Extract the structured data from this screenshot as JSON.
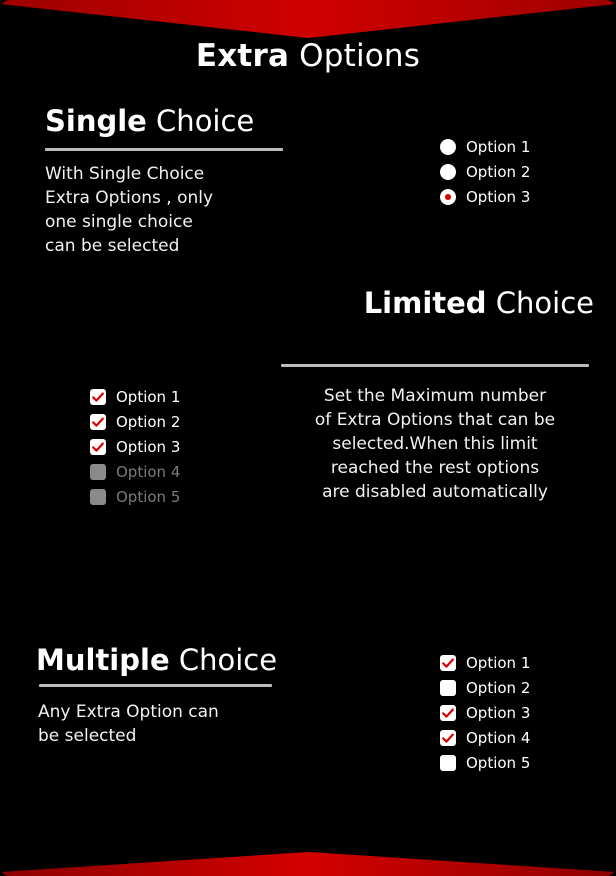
{
  "page": {
    "title_strong": "Extra",
    "title_light": " Options",
    "background_color": "#000000",
    "accent_color": "#d80000",
    "divider_color": "#bcbcbc",
    "disabled_color": "#7b7b7b"
  },
  "decor": {
    "top_chevron_name": "top-red-chevron",
    "bottom_chevron_name": "bottom-red-chevron",
    "chevron_color": "#cc0000",
    "chevron_color_dark": "#9e0000"
  },
  "sections": [
    {
      "id": "single-choice",
      "heading_strong": "Single",
      "heading_light": " Choice",
      "description": "With Single Choice Extra Options ,  only one single choice can be selected",
      "description_lines": [
        "With Single Choice",
        "Extra Options ,  only",
        "one single choice",
        "can be selected"
      ],
      "control_type": "radio",
      "options": [
        {
          "label": "Option 1",
          "checked": false,
          "disabled": false
        },
        {
          "label": "Option 2",
          "checked": false,
          "disabled": false
        },
        {
          "label": "Option 3",
          "checked": true,
          "disabled": false
        }
      ]
    },
    {
      "id": "limited-choice",
      "heading_strong": "Limited",
      "heading_light": " Choice",
      "description": "Set the Maximum number of Extra Options that can be selected.When this limit reached the rest options are disabled automatically",
      "description_lines": [
        "Set the Maximum number",
        "of Extra Options that can be",
        "selected.When this limit",
        "reached the rest options",
        "are disabled automatically"
      ],
      "control_type": "checkbox",
      "options": [
        {
          "label": "Option 1",
          "checked": true,
          "disabled": false
        },
        {
          "label": "Option 2",
          "checked": true,
          "disabled": false
        },
        {
          "label": "Option 3",
          "checked": true,
          "disabled": false
        },
        {
          "label": "Option 4",
          "checked": false,
          "disabled": true
        },
        {
          "label": "Option 5",
          "checked": false,
          "disabled": true
        }
      ]
    },
    {
      "id": "multiple-choice",
      "heading_strong": "Multiple",
      "heading_light": " Choice",
      "description": "Any Extra Option can be selected",
      "description_lines": [
        "Any Extra Option can",
        "be selected"
      ],
      "control_type": "checkbox",
      "options": [
        {
          "label": "Option 1",
          "checked": true,
          "disabled": false
        },
        {
          "label": "Option 2",
          "checked": false,
          "disabled": false
        },
        {
          "label": "Option 3",
          "checked": true,
          "disabled": false
        },
        {
          "label": "Option 4",
          "checked": true,
          "disabled": false
        },
        {
          "label": "Option 5",
          "checked": false,
          "disabled": false
        }
      ]
    }
  ]
}
